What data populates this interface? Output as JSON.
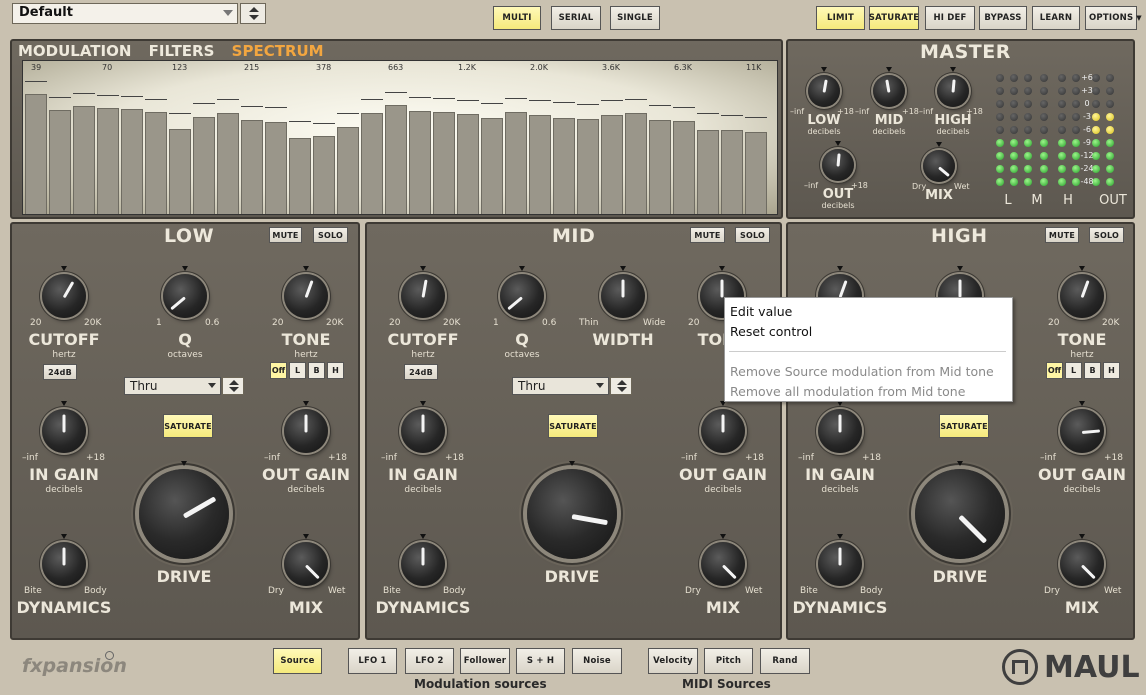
{
  "preset": {
    "value": "Default"
  },
  "top_modes": [
    "MULTI",
    "SERIAL",
    "SINGLE"
  ],
  "top_right": [
    "LIMIT",
    "SATURATE",
    "HI DEF",
    "BYPASS",
    "LEARN",
    "OPTIONS"
  ],
  "tabs": [
    "MODULATION",
    "FILTERS",
    "SPECTRUM"
  ],
  "active_tab": "SPECTRUM",
  "spectrum": {
    "freq_labels": [
      "39",
      "70",
      "123",
      "215",
      "378",
      "663",
      "1.2K",
      "2.0K",
      "3.6K",
      "6.3K",
      "11K"
    ]
  },
  "master": {
    "title": "MASTER",
    "low": {
      "label": "LOW",
      "unit": "decibels",
      "min": "–inf",
      "max": "+18"
    },
    "mid": {
      "label": "MID",
      "unit": "decibels",
      "min": "–inf",
      "max": "+18"
    },
    "high": {
      "label": "HIGH",
      "unit": "decibels",
      "min": "–inf",
      "max": "+18"
    },
    "out": {
      "label": "OUT",
      "unit": "decibels",
      "min": "–inf",
      "max": "+18"
    },
    "mix": {
      "label": "MIX",
      "min": "Dry",
      "max": "Wet"
    },
    "meter_scale": [
      "+6",
      "+3",
      "0",
      "-3",
      "-6",
      "-9",
      "-12",
      "-24",
      "-48"
    ],
    "meter_labels": [
      "L",
      "M",
      "H",
      "OUT"
    ]
  },
  "bands": {
    "low": {
      "title": "LOW",
      "mute": "MUTE",
      "solo": "SOLO",
      "cutoff": {
        "label": "CUTOFF",
        "unit": "hertz",
        "min": "20",
        "max": "20K"
      },
      "q": {
        "label": "Q",
        "unit": "octaves",
        "min": "1",
        "max": "0.6"
      },
      "tone": {
        "label": "TONE",
        "unit": "hertz",
        "min": "20",
        "max": "20K"
      },
      "slope": "24dB",
      "mode": "Thru",
      "tone_toggles": [
        "Off",
        "L",
        "B",
        "H"
      ],
      "in_gain": {
        "label": "IN GAIN",
        "unit": "decibels",
        "min": "–inf",
        "max": "+18"
      },
      "saturate": "SATURATE",
      "out_gain": {
        "label": "OUT GAIN",
        "unit": "decibels",
        "min": "–inf",
        "max": "+18"
      },
      "drive": "DRIVE",
      "dynamics": {
        "label": "DYNAMICS",
        "min": "Bite",
        "max": "Body"
      },
      "mix": {
        "label": "MIX",
        "min": "Dry",
        "max": "Wet"
      }
    },
    "mid": {
      "title": "MID",
      "mute": "MUTE",
      "solo": "SOLO",
      "cutoff": {
        "label": "CUTOFF",
        "unit": "hertz",
        "min": "20",
        "max": "20K"
      },
      "q": {
        "label": "Q",
        "unit": "octaves",
        "min": "1",
        "max": "0.6"
      },
      "width": {
        "label": "WIDTH",
        "min": "Thin",
        "max": "Wide"
      },
      "tone": {
        "label": "TONE",
        "min": "20"
      },
      "slope": "24dB",
      "mode": "Thru",
      "in_gain": {
        "label": "IN GAIN",
        "unit": "decibels",
        "min": "–inf",
        "max": "+18"
      },
      "saturate": "SATURATE",
      "out_gain": {
        "label": "OUT GAIN",
        "unit": "decibels",
        "min": "–inf",
        "max": "+18"
      },
      "drive": "DRIVE",
      "dynamics": {
        "label": "DYNAMICS",
        "min": "Bite",
        "max": "Body"
      },
      "mix": {
        "label": "MIX",
        "min": "Dry",
        "max": "Wet"
      }
    },
    "high": {
      "title": "HIGH",
      "mute": "MUTE",
      "solo": "SOLO",
      "tone": {
        "label": "TONE",
        "unit": "hertz",
        "min": "20",
        "max": "20K"
      },
      "tone_toggles": [
        "Off",
        "L",
        "B",
        "H"
      ],
      "in_gain": {
        "label": "IN GAIN",
        "unit": "decibels",
        "min": "–inf",
        "max": "+18"
      },
      "saturate": "SATURATE",
      "out_gain": {
        "label": "OUT GAIN",
        "unit": "decibels",
        "min": "–inf",
        "max": "+18"
      },
      "drive": "DRIVE",
      "dynamics": {
        "label": "DYNAMICS",
        "min": "Bite",
        "max": "Body"
      },
      "mix": {
        "label": "MIX",
        "min": "Dry",
        "max": "Wet"
      }
    }
  },
  "context_menu": {
    "items": [
      "Edit value",
      "Reset control",
      "Remove Source modulation from Mid tone",
      "Remove all modulation from Mid tone"
    ]
  },
  "footer": {
    "mod_sources": [
      "Source",
      "LFO 1",
      "LFO 2",
      "Follower",
      "S + H",
      "Noise"
    ],
    "mod_label": "Modulation sources",
    "midi_sources": [
      "Velocity",
      "Pitch",
      "Rand"
    ],
    "midi_label": "MIDI Sources",
    "brand": "fxpansion",
    "product": "MAUL"
  }
}
